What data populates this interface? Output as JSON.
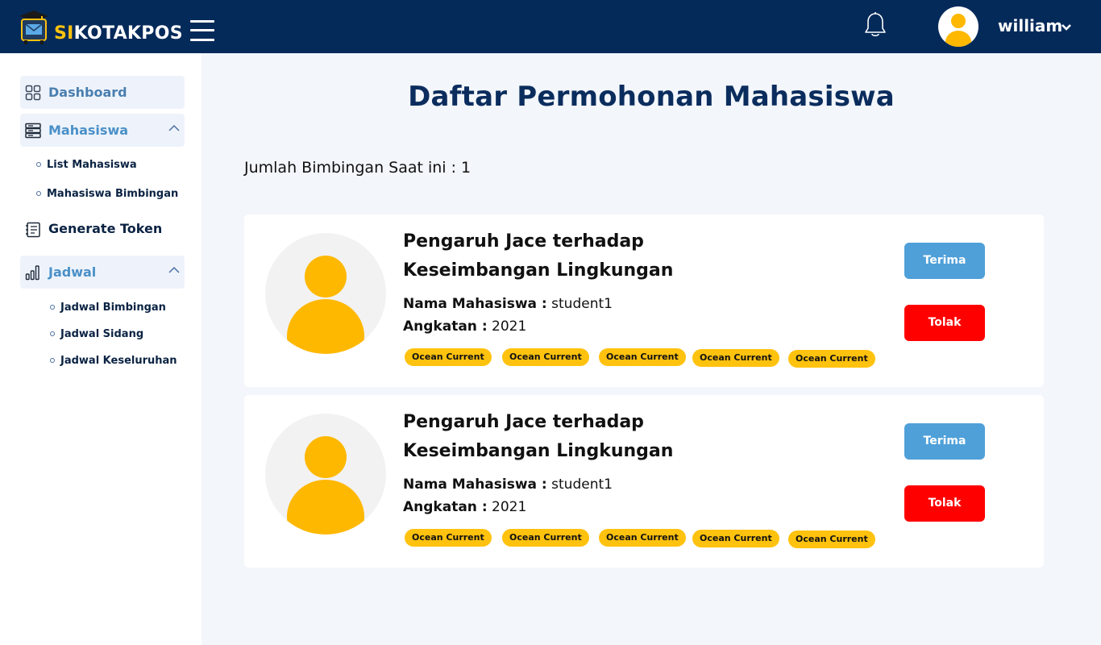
{
  "header": {
    "brand_prefix": "SI",
    "brand_rest": "KOTAKPOS",
    "username": "william"
  },
  "sidebar": {
    "dashboard": "Dashboard",
    "mahasiswa": "Mahasiswa",
    "mahasiswa_sub": [
      "List Mahasiswa",
      "Mahasiswa Bimbingan"
    ],
    "generate_token": "Generate Token",
    "jadwal": "Jadwal",
    "jadwal_sub": [
      "Jadwal Bimbingan",
      "Jadwal Sidang",
      "Jadwal Keseluruhan"
    ]
  },
  "main": {
    "title": "Daftar Permohonan Mahasiswa",
    "count_label": "Jumlah Bimbingan Saat ini : 1"
  },
  "requests": [
    {
      "title_line1": "Pengaruh Jace terhadap",
      "title_line2": "Keseimbangan Lingkungan",
      "name_label": "Nama Mahasiswa :",
      "name_value": "student1",
      "year_label": "Angkatan :",
      "year_value": "2021",
      "tags": [
        "Ocean Current",
        "Ocean Current",
        "Ocean Current",
        "Ocean Current",
        "Ocean Current"
      ],
      "accept_label": "Terima",
      "reject_label": "Tolak"
    },
    {
      "title_line1": "Pengaruh Jace terhadap",
      "title_line2": "Keseimbangan Lingkungan",
      "name_label": "Nama Mahasiswa :",
      "name_value": "student1",
      "year_label": "Angkatan :",
      "year_value": "2021",
      "tags": [
        "Ocean Current",
        "Ocean Current",
        "Ocean Current",
        "Ocean Current",
        "Ocean Current"
      ],
      "accept_label": "Terima",
      "reject_label": "Tolak"
    }
  ],
  "colors": {
    "header_bg": "#042a5a",
    "accent_yellow": "#ffc20e",
    "accept": "#4fa0d9",
    "reject": "#ff0000",
    "sidebar_link": "#4a90c8"
  },
  "icons": [
    "mailbox-logo-icon",
    "hamburger-menu-icon",
    "bell-icon",
    "user-avatar-icon",
    "chevron-down-icon",
    "dashboard-grid-icon",
    "server-list-icon",
    "chevron-up-icon",
    "token-document-icon",
    "bar-chart-icon"
  ]
}
